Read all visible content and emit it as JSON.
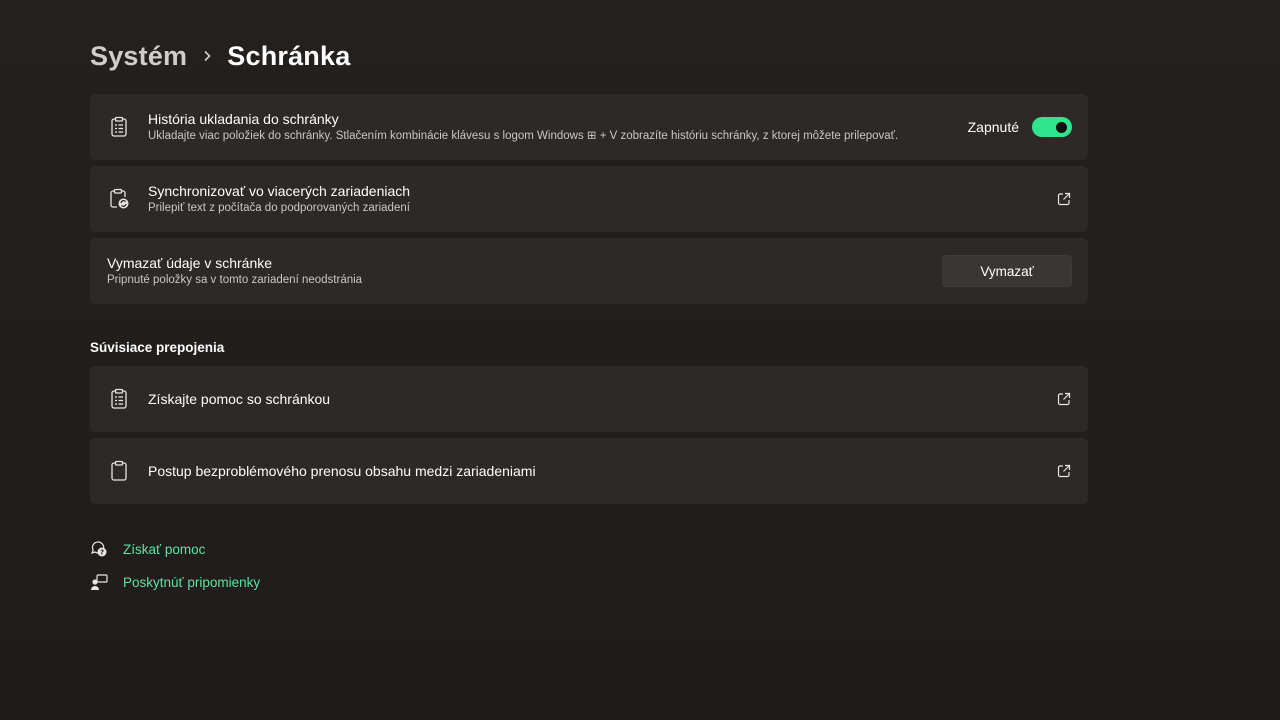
{
  "breadcrumb": {
    "parent": "Systém",
    "current": "Schránka"
  },
  "clipboard_history": {
    "title": "História ukladania do schránky",
    "subtitle": "Ukladajte viac položiek do schránky. Stlačením kombinácie klávesu s logom Windows ⊞ + V zobrazíte históriu schránky, z ktorej môžete prilepovať.",
    "toggle_label": "Zapnuté",
    "toggle_on": true,
    "icon": "clipboard-list-icon"
  },
  "sync": {
    "title": "Synchronizovať vo viacerých zariadeniach",
    "subtitle": "Prilepiť text z počítača do podporovaných zariadení",
    "icon": "clipboard-sync-icon"
  },
  "clear": {
    "title": "Vymazať údaje v schránke",
    "subtitle": "Pripnuté položky sa v tomto zariadení neodstránia",
    "button_label": "Vymazať"
  },
  "related": {
    "title": "Súvisiace prepojenia",
    "items": [
      {
        "label": "Získajte pomoc so schránkou",
        "icon": "clipboard-list-icon"
      },
      {
        "label": "Postup bezproblémového prenosu obsahu medzi zariadeniami",
        "icon": "clipboard-icon"
      }
    ]
  },
  "footer": {
    "help": "Získať pomoc",
    "feedback": "Poskytnúť pripomienky"
  },
  "colors": {
    "background": "#221f1d",
    "card": "#2c2927",
    "accent": "#2ee58c",
    "link": "#5fe0a0"
  }
}
